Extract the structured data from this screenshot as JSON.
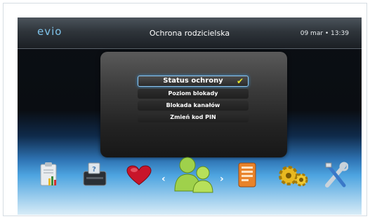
{
  "header": {
    "logo": "evio",
    "title": "Ochrona rodzicielska",
    "datetime": "09 mar • 13:39"
  },
  "menu": {
    "items": [
      {
        "label": "Status ochrony",
        "selected": true,
        "checked": true
      },
      {
        "label": "Poziom blokady"
      },
      {
        "label": "Blokada kanałów"
      },
      {
        "label": "Zmień kod PIN"
      }
    ]
  },
  "nav": {
    "left_arrow": "‹",
    "right_arrow": "›",
    "icons": [
      "clipboard-chart-icon",
      "tv-printer-icon",
      "heart-icon",
      "parental-control-icon",
      "calendar-guide-icon",
      "gears-icon",
      "tools-icon"
    ]
  },
  "colors": {
    "accent": "#8ec7f2",
    "logo": "#7fc3ea",
    "check": "#e4e62a"
  }
}
